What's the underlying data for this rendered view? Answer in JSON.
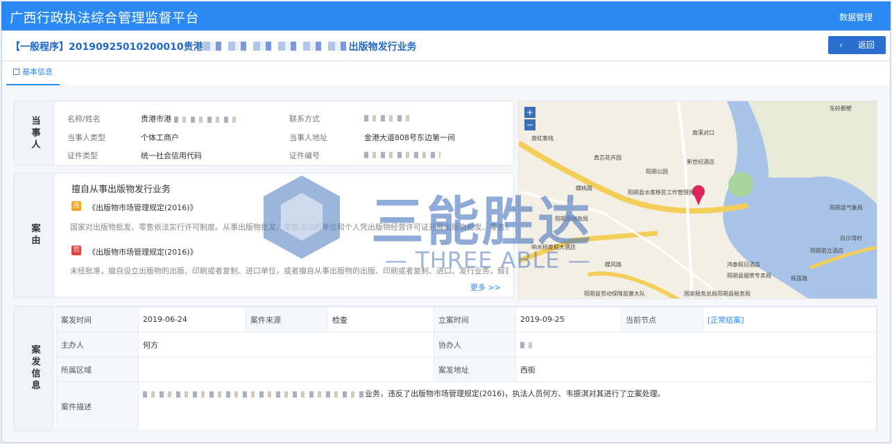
{
  "app": {
    "title": "广西行政执法综合管理监督平台",
    "nav_item": "数据管理"
  },
  "case": {
    "title_prefix": "【一般程序】20190925010200010贵港",
    "title_suffix": "出版物发行业务",
    "back_label": "返回",
    "back_arrow": "‹"
  },
  "tabs": [
    {
      "label": "基本信息",
      "icon": "document-icon"
    }
  ],
  "party": {
    "section_label": "当事人",
    "fields": [
      {
        "label": "名称/姓名",
        "value": "贵港市港"
      },
      {
        "label": "联系方式",
        "value": ""
      },
      {
        "label": "当事人类型",
        "value": "个体工商户"
      },
      {
        "label": "当事人地址",
        "value": "金港大道808号东边第一间"
      },
      {
        "label": "证件类型",
        "value": "统一社会信用代码"
      },
      {
        "label": "证件编号",
        "value": ""
      }
    ]
  },
  "reason": {
    "section_label": "案由",
    "title": "擅自从事出版物发行业务",
    "items": [
      {
        "badge": "违",
        "badge_color": "#f5a623",
        "law": "《出版物市场管理规定(2016)》",
        "text": "国家对出版物批发、零售依法实行许可制度。从事出版物批发、零售活动的单位和个人凭出版物经营许可证开展出版物批发、零售活动"
      },
      {
        "badge": "罚",
        "badge_color": "#e8413c",
        "law": "《出版物市场管理规定(2016)》",
        "text": "未经批准，擅自设立出版物的出版、印刷或者复制、进口单位，或者擅自从事出版物的出版、印刷或者复制、进口、发行业务，假冒"
      }
    ],
    "more": "更多 >>"
  },
  "map": {
    "zoom_in": "+",
    "zoom_out": "−",
    "labels": [
      "东岭郡壁",
      "南虹客栈",
      "南溪对口",
      "新世纪酒店",
      "真芯花卉园",
      "阳朔公园",
      "阳朔县水库移民工作管理局",
      "阳朔县财政局",
      "阳朔县气象局",
      "响水桥度假大酒店",
      "阳朔县劳动保障监察大队",
      "蝶桃路",
      "阳朔若立酒店",
      "鸿泰假日酒店",
      "阳朔县烟草专卖局",
      "国家税务总局阳朔县税务局",
      "白沙湾村",
      "规莲路",
      "蝶风路"
    ]
  },
  "incident": {
    "section_label": "案发信息",
    "rows": {
      "occur_time_label": "案发时间",
      "occur_time": "2019-06-24",
      "source_label": "案件来源",
      "source": "检查",
      "file_time_label": "立案时间",
      "file_time": "2019-09-25",
      "node_label": "当前节点",
      "node": "[正常结案]",
      "host_label": "主办人",
      "host": "何方",
      "assist_label": "协办人",
      "assist": "",
      "area_label": "所属区域",
      "area": "",
      "address_label": "案发地址",
      "address": "西街",
      "desc_label": "案件描述",
      "desc": "业务，违反了出版物市场管理规定(2016)，执法人员何方、韦振淇对其进行了立案处理。"
    }
  },
  "watermark": {
    "cn": "三能胜达",
    "en": "— THREE ABLE —"
  }
}
